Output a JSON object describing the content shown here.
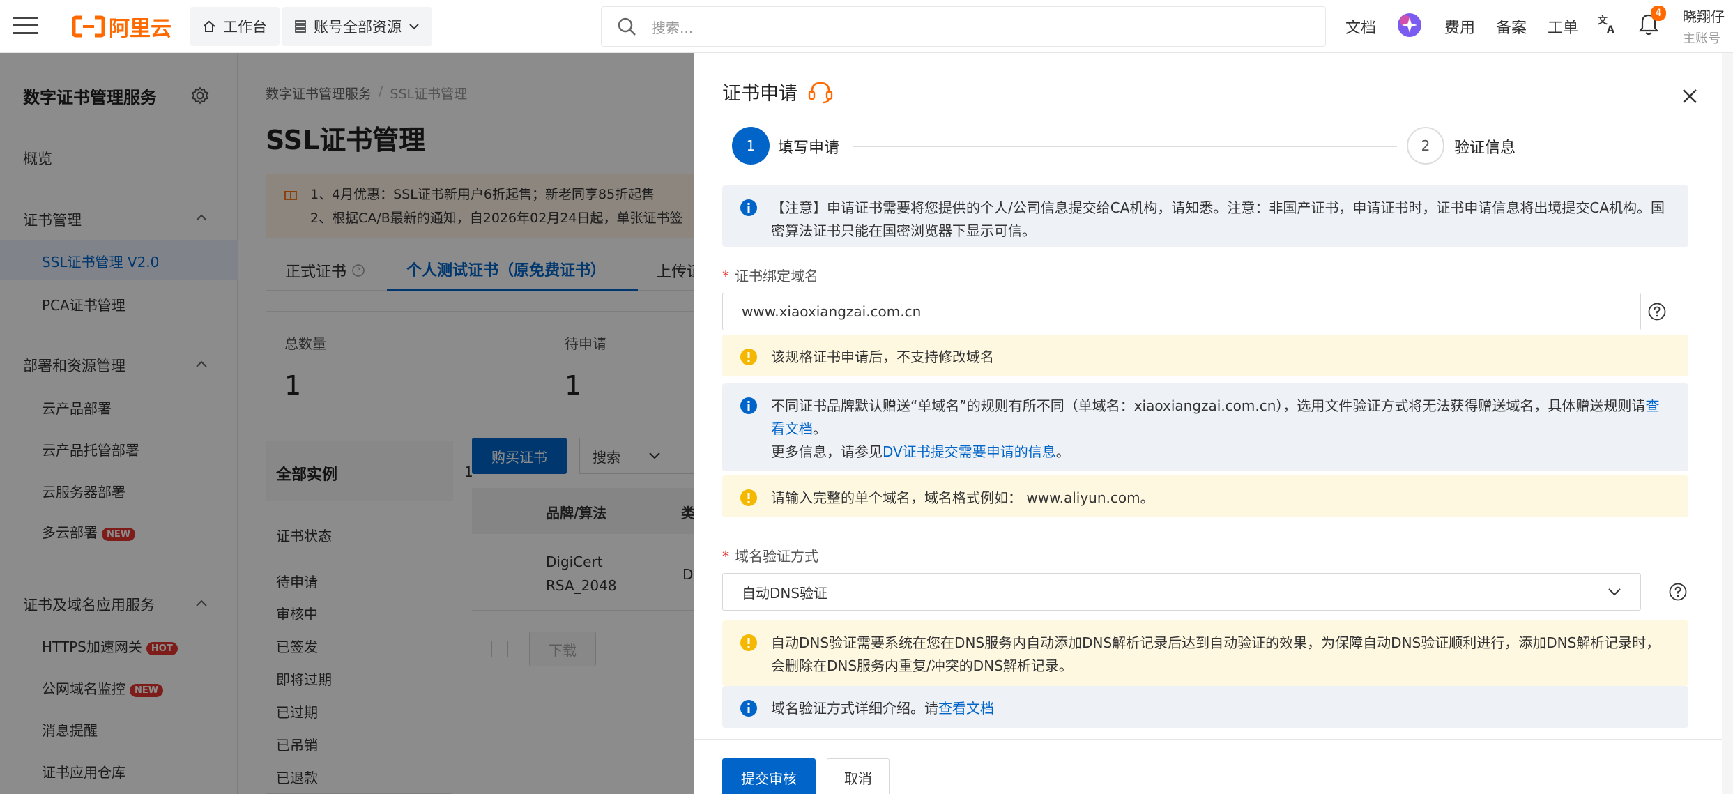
{
  "topbar": {
    "logo_text": "阿里云",
    "workbench_label": "工作台",
    "resources_label": "账号全部资源",
    "search_placeholder": "搜索...",
    "nav": [
      "文档",
      "费用",
      "备案",
      "工单"
    ],
    "notification_count": "4",
    "user_name": "晓翔仔",
    "user_role": "主账号"
  },
  "sidebar": {
    "title": "数字证书管理服务",
    "overview": "概览",
    "groups": [
      {
        "label": "证书管理",
        "items": [
          "SSL证书管理 V2.0",
          "PCA证书管理"
        ]
      },
      {
        "label": "部署和资源管理",
        "items": [
          "云产品部署",
          "云产品托管部署",
          "云服务器部署",
          "多云部署"
        ]
      },
      {
        "label": "证书及域名应用服务",
        "items": [
          "HTTPS加速网关",
          "公网域名监控",
          "消息提醒",
          "证书应用仓库"
        ]
      }
    ],
    "badges": {
      "new": "NEW",
      "hot": "HOT"
    }
  },
  "main": {
    "breadcrumb": [
      "数字证书管理服务",
      "/",
      "SSL证书管理"
    ],
    "title": "SSL证书管理",
    "notice": [
      "1、4月优惠：SSL证书新用户6折起售；新老同享85折起售",
      "2、根据CA/B最新的通知，自2026年02月24日起，单张证书签"
    ],
    "tabs": [
      "正式证书",
      "个人测试证书（原免费证书）",
      "上传证"
    ],
    "stats": [
      {
        "label": "总数量",
        "value": "1"
      },
      {
        "label": "待申请",
        "value": "1"
      }
    ],
    "filter_title": "全部实例",
    "filter_count": "1",
    "filter_group": "证书状态",
    "filter_items": [
      "待申请",
      "审核中",
      "已签发",
      "即将过期",
      "已过期",
      "已吊销",
      "已退款"
    ],
    "buy_button": "购买证书",
    "search_select": "搜索",
    "table_header": "品牌/算法",
    "table_header2": "类",
    "row_brand": "DigiCert",
    "row_algo": "RSA_2048",
    "row_cut": "D",
    "download_button": "下载"
  },
  "drawer": {
    "title": "证书申请",
    "steps": [
      {
        "num": "1",
        "label": "填写申请"
      },
      {
        "num": "2",
        "label": "验证信息"
      }
    ],
    "notice_top": "【注意】申请证书需要将您提供的个人/公司信息提交给CA机构，请知悉。注意：非国产证书，申请证书时，证书申请信息将出境提交CA机构。国密算法证书只能在国密浏览器下显示可信。",
    "domain_label": "证书绑定域名",
    "domain_value": "www.xiaoxiangzai.com.cn",
    "warn_domain": "该规格证书申请后，不支持修改域名",
    "info_gift_1": "不同证书品牌默认赠送“单域名”的规则有所不同（单域名：xiaoxiangzai.com.cn），选用文件验证方式将无法获得赠送域名，具体赠送规则请",
    "info_gift_link": "查看文档",
    "info_gift_end": "。",
    "info_gift_2": "更多信息，请参见",
    "info_gift_link2": "DV证书提交需要申请的信息",
    "warn_format": "请输入完整的单个域名，域名格式例如： www.aliyun.com。",
    "verify_label": "域名验证方式",
    "verify_value": "自动DNS验证",
    "warn_dns": "自动DNS验证需要系统在您在DNS服务内自动添加DNS解析记录后达到自动验证的效果，为保障自动DNS验证顺利进行，添加DNS解析记录时，会删除在DNS服务内重复/冲突的DNS解析记录。",
    "info_verify": "域名验证方式详细介绍。请",
    "info_verify_link": "查看文档",
    "submit": "提交审核",
    "cancel": "取消"
  },
  "colors": {
    "brand": "#ff6a00",
    "primary": "#0064c8",
    "info_icon": "#0064c8",
    "warn_icon": "#f5b800",
    "badge": "#e3342f"
  }
}
